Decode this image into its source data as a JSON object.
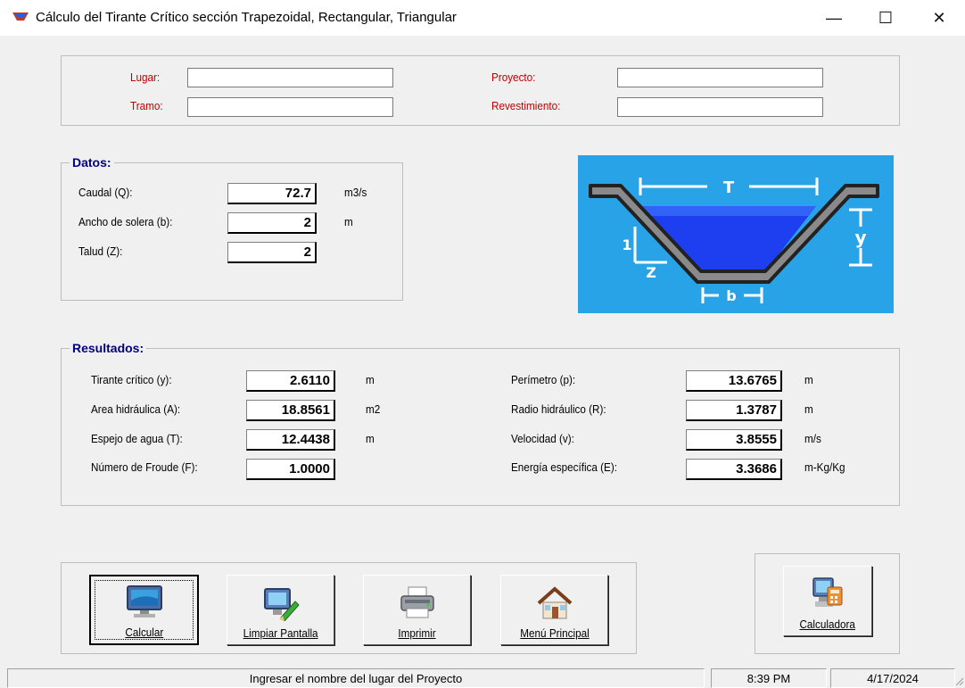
{
  "window": {
    "title": "Cálculo del Tirante Crítico sección Trapezoidal, Rectangular, Triangular",
    "minimize": "—",
    "maximize": "☐",
    "close": "✕"
  },
  "project": {
    "lugar_label": "Lugar:",
    "tramo_label": "Tramo:",
    "proyecto_label": "Proyecto:",
    "revestimiento_label": "Revestimiento:",
    "lugar_value": "",
    "tramo_value": "",
    "proyecto_value": "",
    "revestimiento_value": ""
  },
  "datos": {
    "legend": "Datos:",
    "rows": [
      {
        "label": "Caudal (Q):",
        "value": "72.7",
        "unit": "m3/s"
      },
      {
        "label": "Ancho de solera (b):",
        "value": "2",
        "unit": "m"
      },
      {
        "label": "Talud (Z):",
        "value": "2",
        "unit": ""
      }
    ]
  },
  "diagram": {
    "T": "T",
    "y": "y",
    "one": "1",
    "z": "Z",
    "b": "b",
    "bg_color": "#29a3e8",
    "water_color": "#1e3ff0"
  },
  "resultados": {
    "legend": "Resultados:",
    "left": [
      {
        "label": "Tirante crítico (y):",
        "value": "2.6110",
        "unit": "m"
      },
      {
        "label": "Area hidráulica (A):",
        "value": "18.8561",
        "unit": "m2"
      },
      {
        "label": "Espejo de agua (T):",
        "value": "12.4438",
        "unit": "m"
      },
      {
        "label": "Número de Froude (F):",
        "value": "1.0000",
        "unit": ""
      }
    ],
    "right": [
      {
        "label": "Perímetro (p):",
        "value": "13.6765",
        "unit": "m"
      },
      {
        "label": "Radio hidráulico (R):",
        "value": "1.3787",
        "unit": "m"
      },
      {
        "label": "Velocidad (v):",
        "value": "3.8555",
        "unit": "m/s"
      },
      {
        "label": "Energía específica (E):",
        "value": "3.3686",
        "unit": "m-Kg/Kg"
      }
    ]
  },
  "buttons": {
    "calcular": "Calcular",
    "limpiar": "Limpiar Pantalla",
    "imprimir": "Imprimir",
    "menu": "Menú Principal",
    "calculadora": "Calculadora"
  },
  "status": {
    "message": "Ingresar el nombre del lugar del Proyecto",
    "time": "8:39 PM",
    "date": "4/17/2024"
  }
}
